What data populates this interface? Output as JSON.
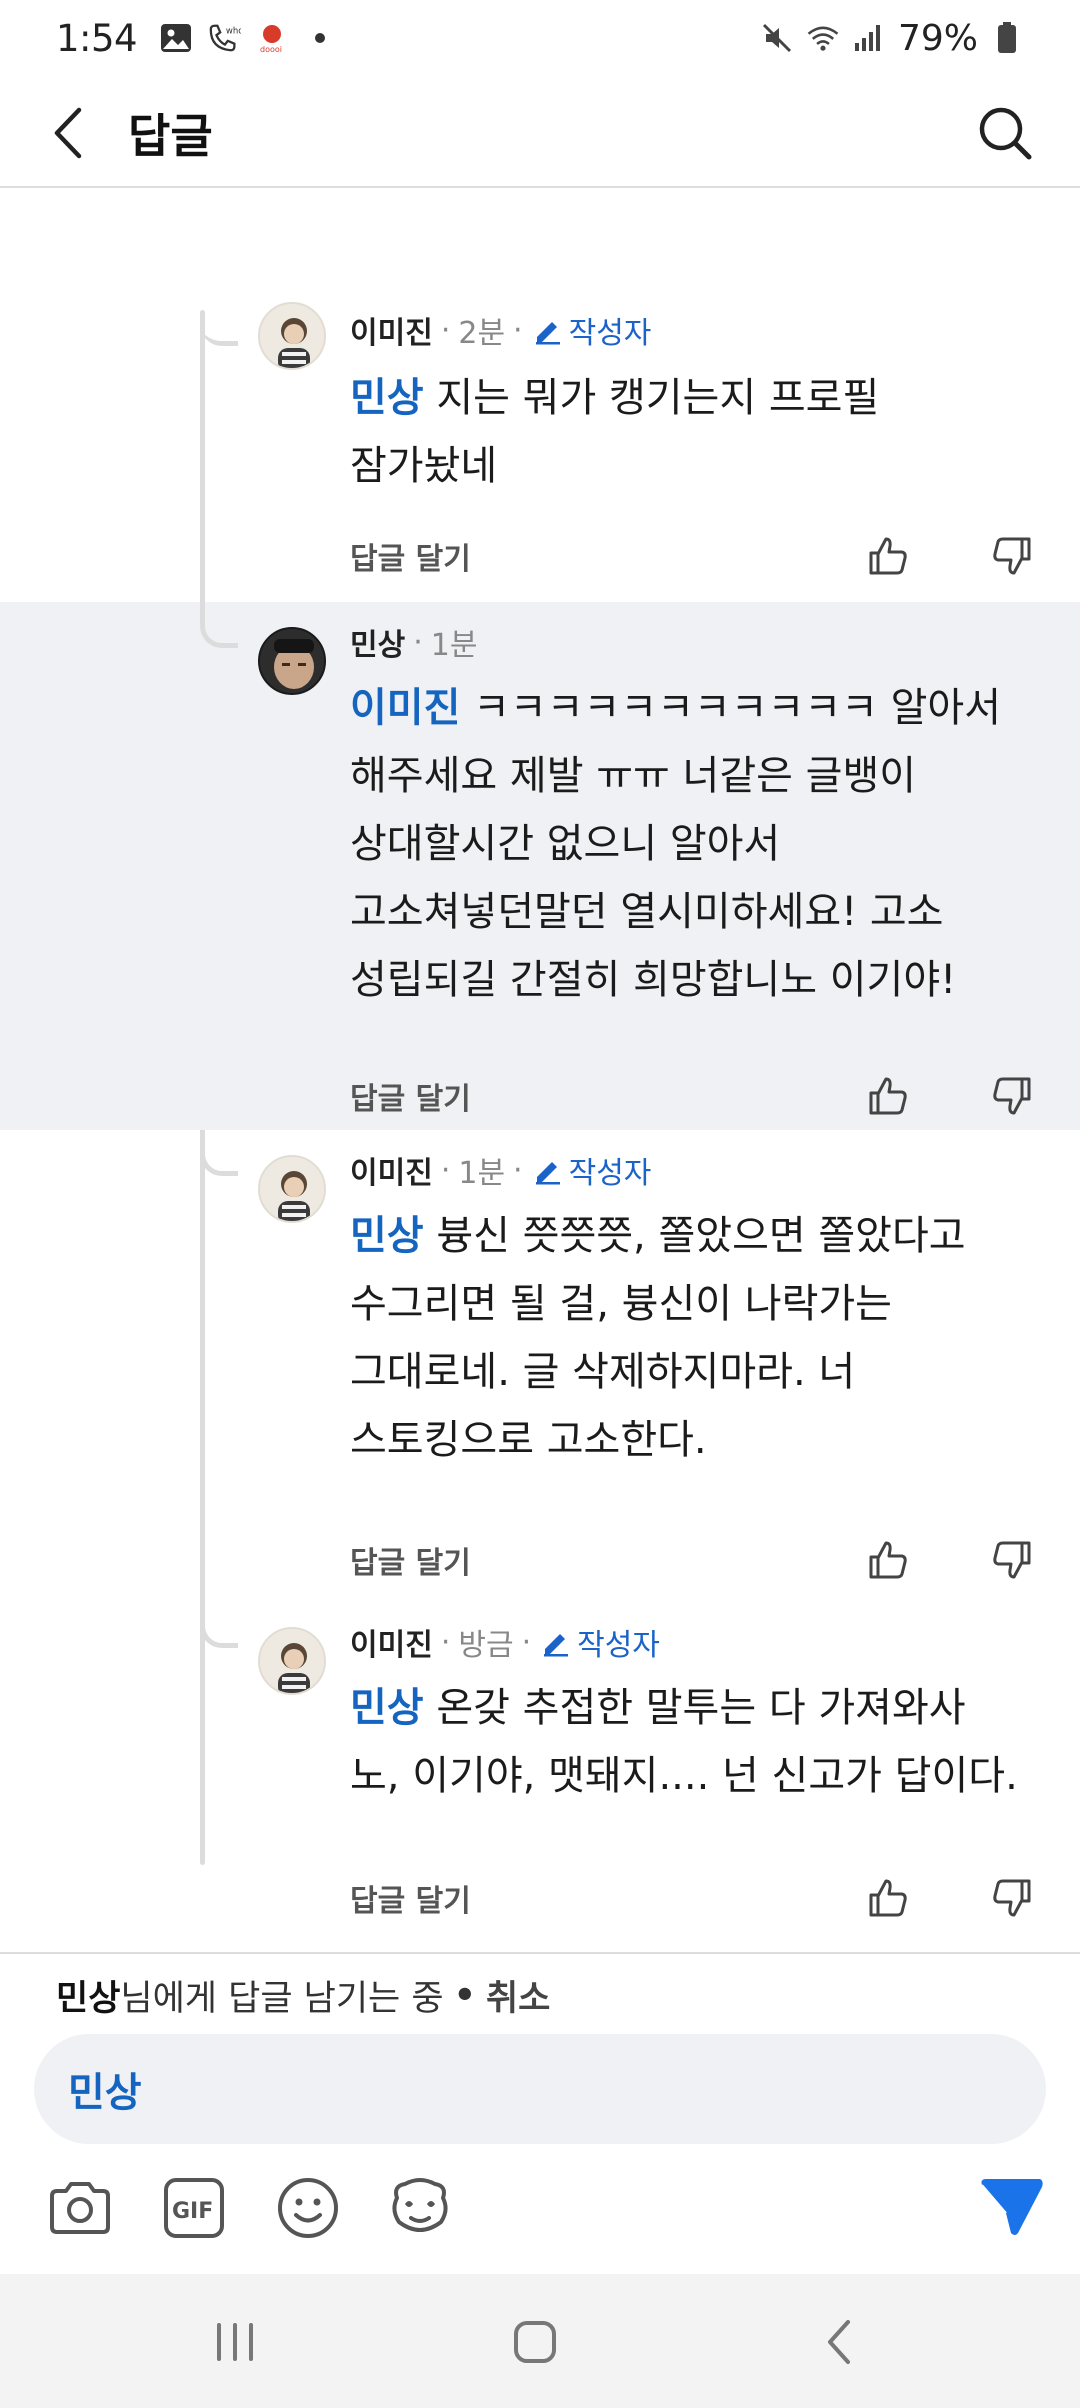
{
  "status_bar": {
    "time": "1:54",
    "battery": "79%",
    "icons_left": [
      "gallery-icon",
      "wifi-call-icon",
      "app-notification-icon",
      "dot-icon"
    ],
    "icons_right": [
      "mute-icon",
      "wifi-icon",
      "signal-icon",
      "battery-icon"
    ]
  },
  "header": {
    "title": "답글",
    "back_icon": "chevron-left-icon",
    "search_icon": "search-icon"
  },
  "comments": [
    {
      "author": "이미진",
      "time": "2분",
      "op_badge": "작성자",
      "mention": "민상",
      "text_lines": [
        " 지는 뭐가 캥기는지 프로필",
        "잠가놨네"
      ],
      "reply_label": "답글 달기"
    },
    {
      "author": "민상",
      "time": "1분",
      "mention": "이미진",
      "text_lines": [
        " ㅋㅋㅋㅋㅋㅋㅋㅋㅋㅋㅋ 알아서",
        "해주세요 제발 ㅠㅠ 너같은 글뱅이",
        "상대할시간 없으니 알아서",
        "고소쳐넣던말던 열시미하세요! 고소",
        "성립되길 간절히 희망합니노 이기야!"
      ],
      "reply_label": "답글 달기"
    },
    {
      "author": "이미진",
      "time": "1분",
      "op_badge": "작성자",
      "mention": "민상",
      "text_lines": [
        " 븅신 쯧쯧쯧, 쫄았으면 쫄았다고",
        "수그리면 될 걸, 븅신이 나락가는",
        "그대로네. 글 삭제하지마라. 너",
        "스토킹으로 고소한다."
      ],
      "reply_label": "답글 달기"
    },
    {
      "author": "이미진",
      "time": "방금",
      "op_badge": "작성자",
      "mention": "민상",
      "text_lines": [
        " 온갖 추접한 말투는 다 가져와사",
        "노, 이기야, 맷돼지.... 넌 신고가 답이다."
      ],
      "reply_label": "답글 달기"
    }
  ],
  "composer": {
    "replying_to": "민상",
    "replying_suffix": "님에게 답글 남기는 중",
    "separator": "•",
    "cancel_label": "취소",
    "input_value": "민상",
    "tools": [
      "camera-icon",
      "gif-icon",
      "emoji-icon",
      "sticker-icon"
    ],
    "send_icon": "send-icon"
  },
  "colors": {
    "accent": "#1565c0",
    "highlight_bg": "#f0f1f4",
    "send": "#1a73e8"
  }
}
